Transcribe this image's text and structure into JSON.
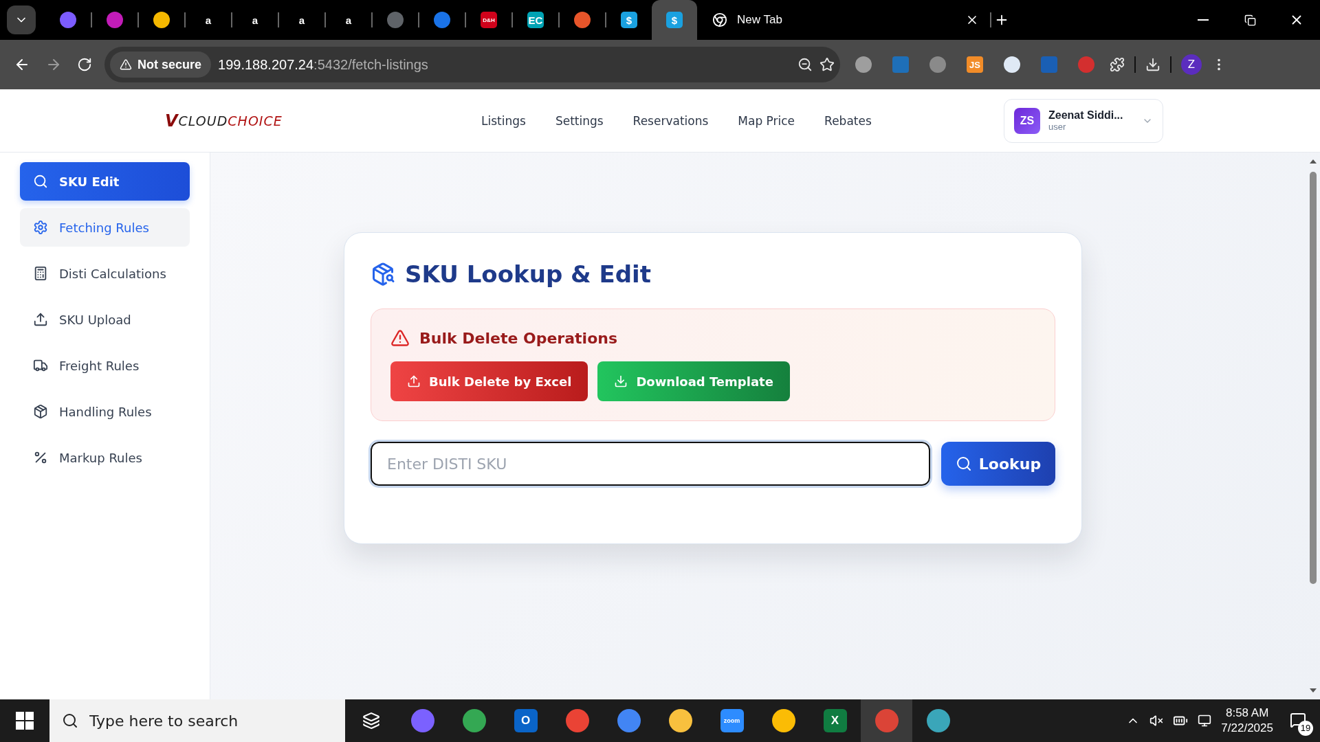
{
  "browser": {
    "pinned_tabs": [
      {
        "color": "#7c5cff",
        "selected": false
      },
      {
        "color": "#c21cb8",
        "selected": false
      },
      {
        "color": "#f5b800",
        "selected": false
      },
      {
        "color": "#000000",
        "glyph": "a",
        "selected": false
      },
      {
        "color": "#000000",
        "glyph": "a",
        "selected": false
      },
      {
        "color": "#000000",
        "glyph": "a",
        "selected": false
      },
      {
        "color": "#000000",
        "glyph": "a",
        "selected": false
      },
      {
        "color": "#5f6368",
        "selected": false
      },
      {
        "color": "#1a73e8",
        "selected": false
      },
      {
        "color": "#d0021b",
        "glyph": "D&H",
        "selected": false
      },
      {
        "color": "#00a3b4",
        "glyph": "EC",
        "selected": false
      },
      {
        "color": "#e8552a",
        "selected": false
      },
      {
        "color": "#1aa1e0",
        "glyph": "$",
        "selected": false
      },
      {
        "color": "#1aa1e0",
        "glyph": "$",
        "selected": true
      }
    ],
    "tab": {
      "title": "New Tab",
      "selected": false
    },
    "address": {
      "security": "Not secure",
      "host": "199.188.207.24",
      "path": ":5432/fetch-listings"
    },
    "extensions": [
      {
        "color": "#9e9e9e"
      },
      {
        "color": "#1e6fb8"
      },
      {
        "color": "#8a8a8a"
      },
      {
        "color": "#f28c28",
        "glyph": "JS"
      },
      {
        "color": "#dfe9f5"
      },
      {
        "color": "#1a5fb4"
      },
      {
        "color": "#d32f2f"
      }
    ],
    "profile": "Z"
  },
  "app": {
    "logo": {
      "mark": "V",
      "first": "CLOUD",
      "second": "CHOICE"
    },
    "nav": [
      "Listings",
      "Settings",
      "Reservations",
      "Map Price",
      "Rebates"
    ],
    "user": {
      "initials": "ZS",
      "name": "Zeenat Siddi...",
      "role": "user"
    }
  },
  "sidebar": {
    "items": [
      {
        "label": "SKU Edit",
        "selected": true,
        "highlighted": false
      },
      {
        "label": "Fetching Rules",
        "selected": false,
        "highlighted": true
      },
      {
        "label": "Disti Calculations",
        "selected": false,
        "highlighted": false
      },
      {
        "label": "SKU Upload",
        "selected": false,
        "highlighted": false
      },
      {
        "label": "Freight Rules",
        "selected": false,
        "highlighted": false
      },
      {
        "label": "Handling Rules",
        "selected": false,
        "highlighted": false
      },
      {
        "label": "Markup Rules",
        "selected": false,
        "highlighted": false
      }
    ]
  },
  "card": {
    "title": "SKU Lookup & Edit",
    "alert": {
      "title": "Bulk Delete Operations",
      "buttons": [
        {
          "label": "Bulk Delete by Excel",
          "kind": "danger"
        },
        {
          "label": "Download Template",
          "kind": "success"
        }
      ]
    },
    "search": {
      "placeholder": "Enter DISTI SKU"
    },
    "lookup_button": "Lookup"
  },
  "taskbar": {
    "search": {
      "placeholder": "Type here to search"
    },
    "apps": [
      {
        "color": "#7b61ff",
        "selected": false
      },
      {
        "color": "#34a853",
        "selected": false
      },
      {
        "color": "#0a64c8",
        "glyph": "O",
        "selected": false
      },
      {
        "color": "#ea4335",
        "selected": false
      },
      {
        "color": "#4285f4",
        "selected": false
      },
      {
        "color": "#f8c03e",
        "selected": false
      },
      {
        "color": "#2d8cff",
        "glyph": "zoom",
        "selected": false
      },
      {
        "color": "#fbbc05",
        "selected": false
      },
      {
        "color": "#107c41",
        "glyph": "X",
        "selected": false
      },
      {
        "color": "#db4437",
        "selected": true
      },
      {
        "color": "#3aa6b9",
        "selected": false
      }
    ],
    "time": "8:58 AM",
    "date": "7/22/2025",
    "notifications": "19"
  }
}
